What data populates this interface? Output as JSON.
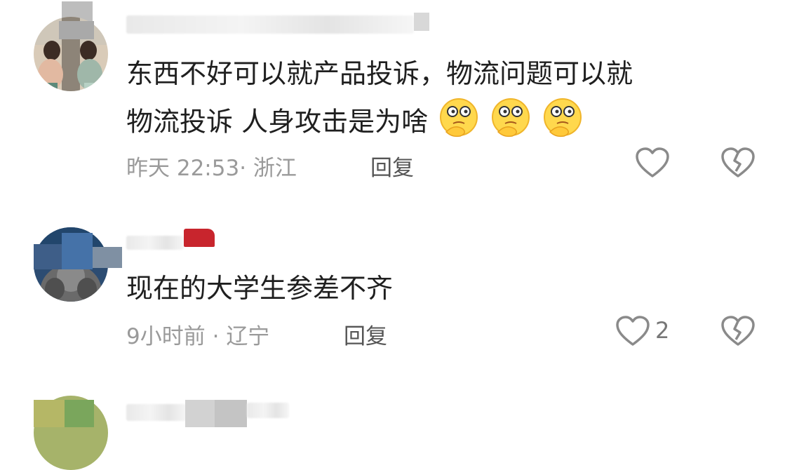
{
  "comments": [
    {
      "text_line1": "东西不好可以就产品投诉，物流问题可以就",
      "text_line2": "物流投诉 人身攻击是为啥",
      "emoji_name": "thinking-face-emoji",
      "emoji_count": 3,
      "timestamp": "昨天 22:53",
      "separator": "·",
      "location": "浙江",
      "reply_label": "回复",
      "like_count": ""
    },
    {
      "text_line1": "现在的大学生参差不齐",
      "timestamp": "9小时前",
      "separator": "·",
      "location": "辽宁",
      "reply_label": "回复",
      "like_count": "2"
    }
  ],
  "colors": {
    "text": "#1f1f1f",
    "meta": "#9a9a9a",
    "icon_stroke": "#8a8a8a",
    "emoji_fill": "#ffd84d",
    "flag_red": "#c8252d"
  },
  "icons": [
    "heart-outline-icon",
    "broken-heart-icon",
    "thinking-face-emoji"
  ]
}
